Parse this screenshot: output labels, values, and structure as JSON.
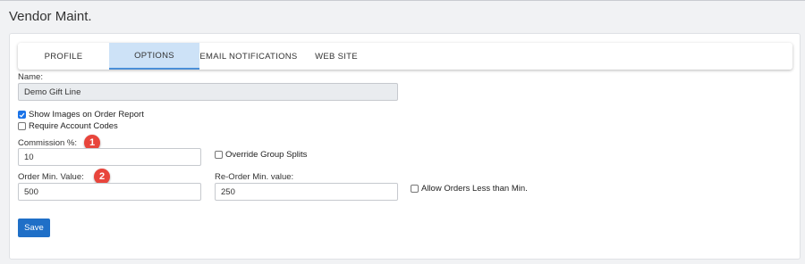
{
  "page": {
    "title": "Vendor Maint."
  },
  "tabs": [
    {
      "label": "PROFILE"
    },
    {
      "label": "OPTIONS"
    },
    {
      "label": "EMAIL NOTIFICATIONS"
    },
    {
      "label": "WEB SITE"
    }
  ],
  "active_tab": "OPTIONS",
  "form": {
    "name_label": "Name:",
    "name_value": "Demo Gift Line",
    "show_images_label": "Show Images on Order Report",
    "show_images_checked": true,
    "require_codes_label": "Require Account Codes",
    "require_codes_checked": false,
    "commission_label": "Commission %:",
    "commission_value": "10",
    "override_splits_label": "Override Group Splits",
    "override_splits_checked": false,
    "order_min_label": "Order Min. Value:",
    "order_min_value": "500",
    "reorder_min_label": "Re-Order Min. value:",
    "reorder_min_value": "250",
    "allow_less_label": "Allow Orders Less than Min.",
    "allow_less_checked": false,
    "save_label": "Save"
  },
  "markers": {
    "one": "1",
    "two": "2"
  },
  "colors": {
    "accent": "#1f6fc7",
    "active_tab_bg": "#cde2f7",
    "marker": "#e8453c"
  }
}
